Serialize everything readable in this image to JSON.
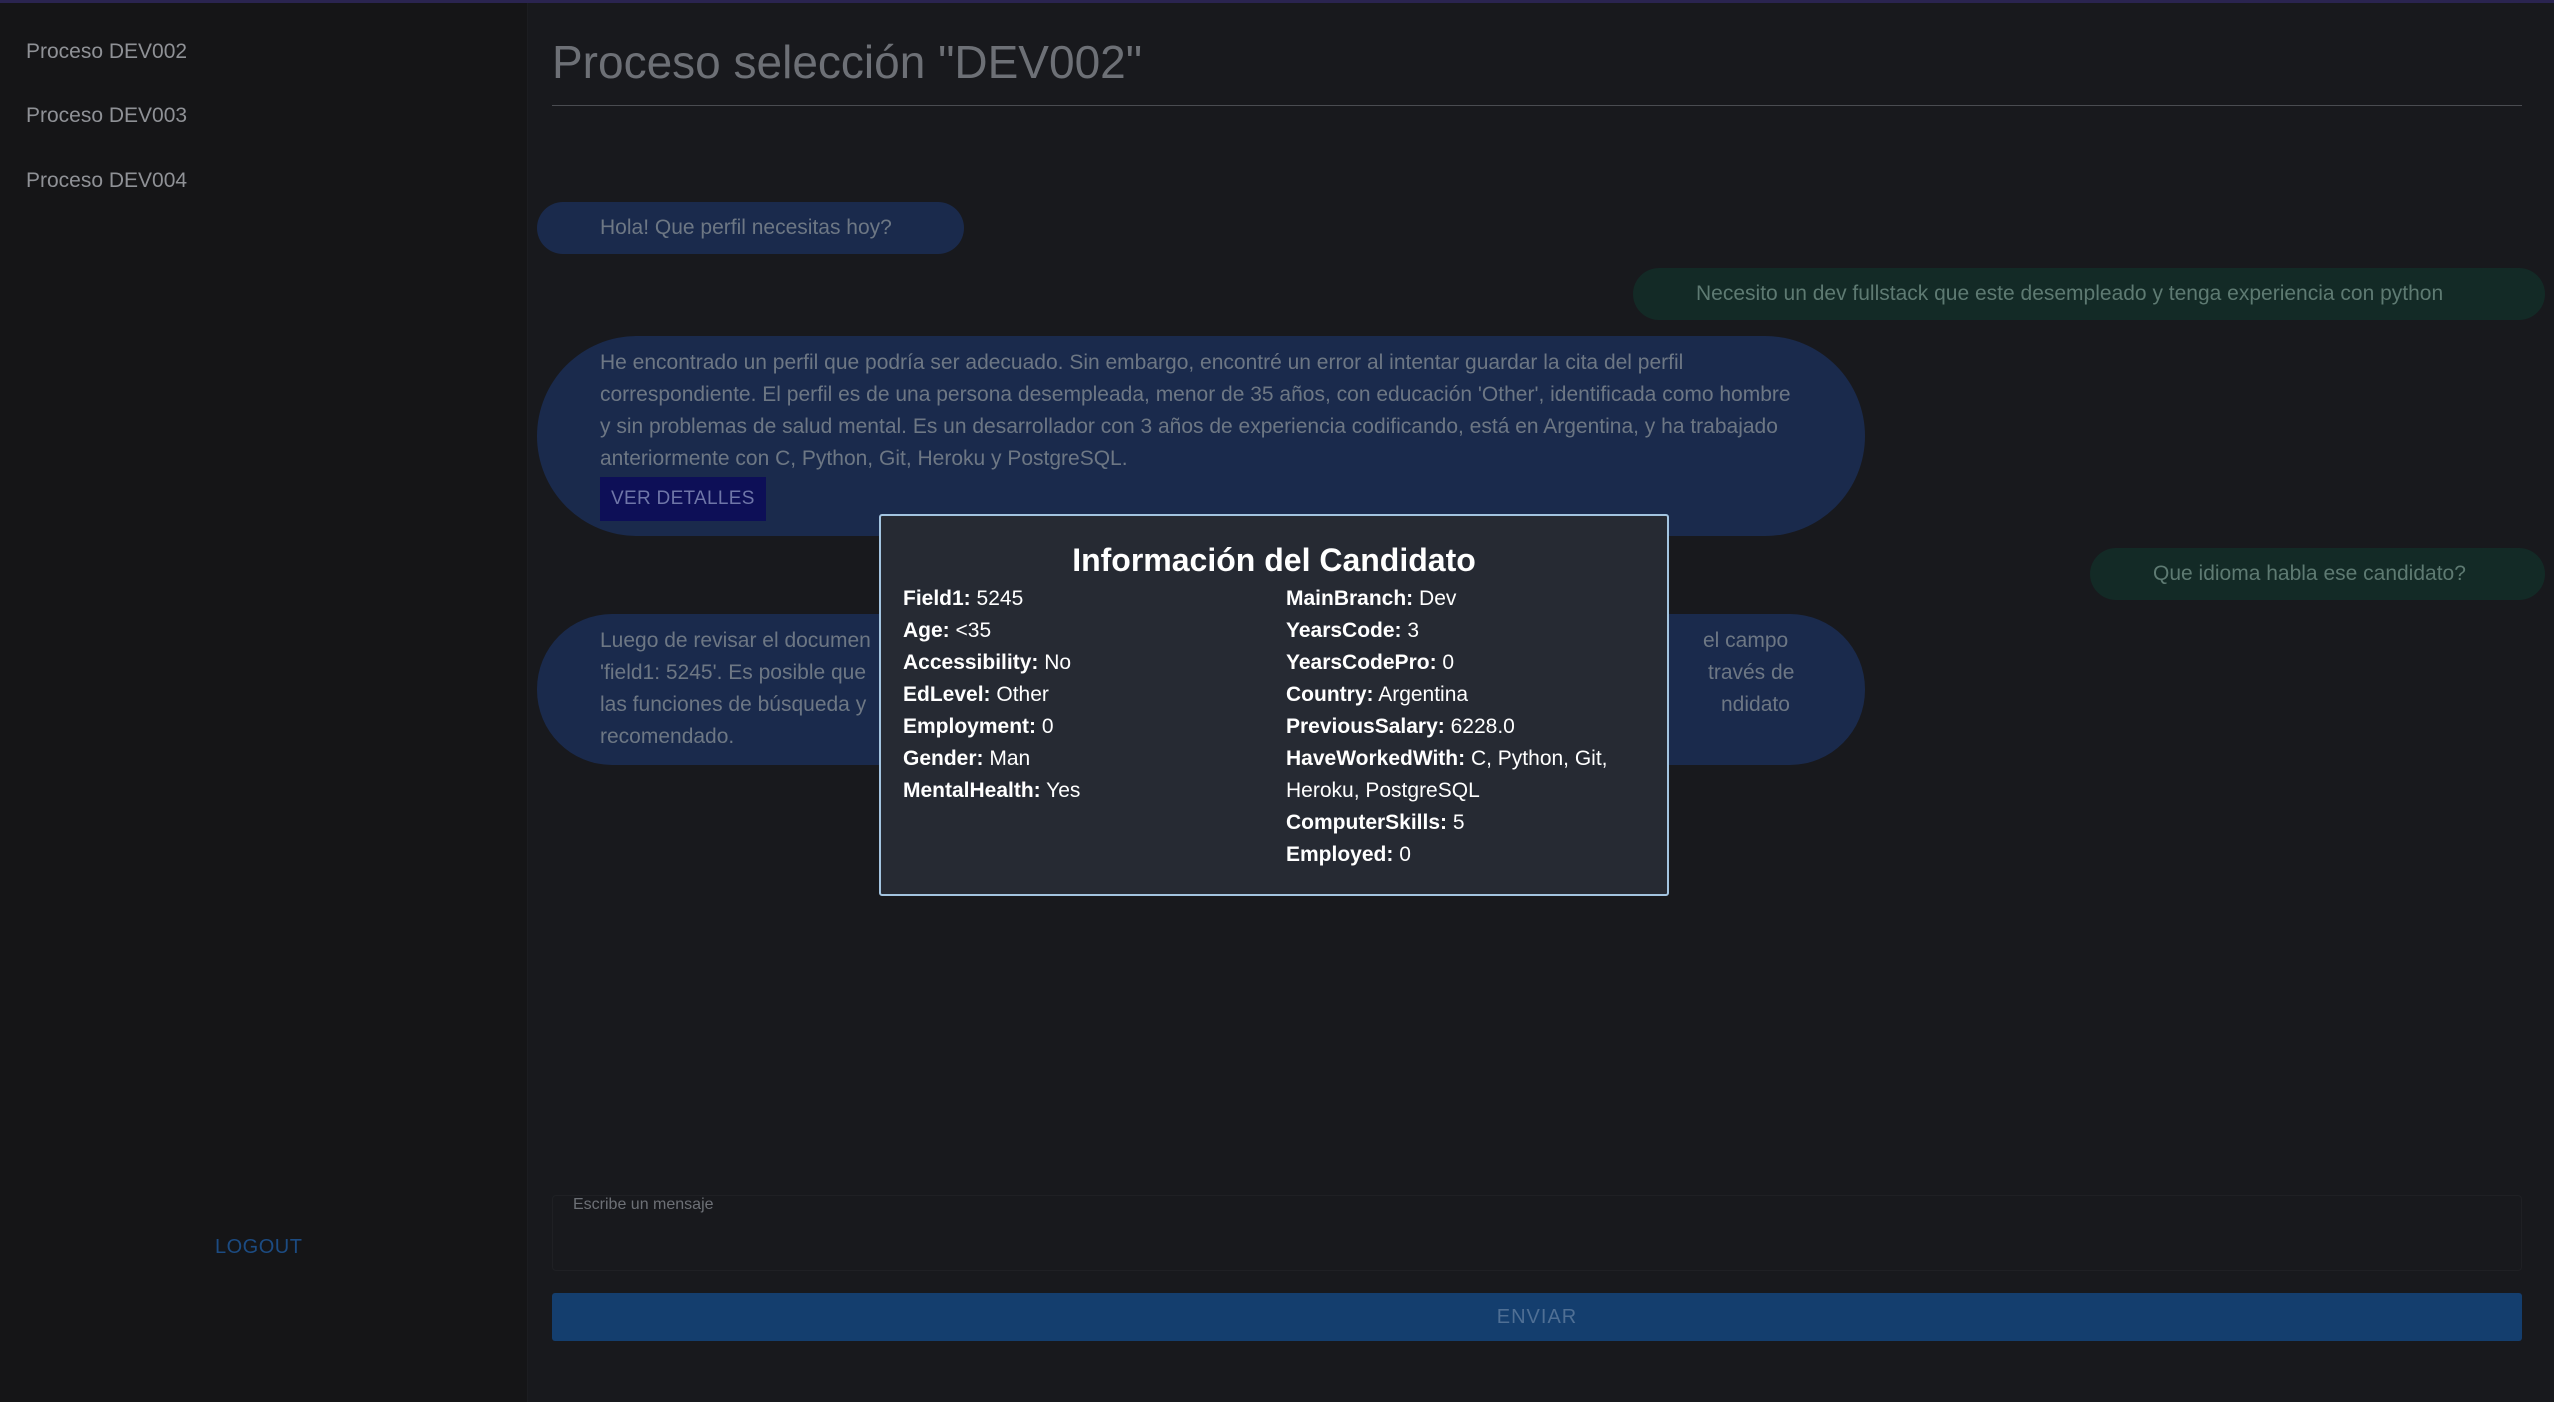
{
  "sidebar": {
    "items": [
      {
        "label": "Proceso DEV002"
      },
      {
        "label": "Proceso DEV003"
      },
      {
        "label": "Proceso DEV004"
      }
    ],
    "logout_label": "LOGOUT"
  },
  "main": {
    "title": "Proceso selección \"DEV002\"",
    "messages": [
      {
        "role": "bot",
        "text": "Hola! Que perfil necesitas hoy?"
      },
      {
        "role": "user",
        "text": "Necesito un dev fullstack que este desempleado y tenga experiencia con python"
      },
      {
        "role": "bot",
        "text": "He encontrado un perfil que podría ser adecuado. Sin embargo, encontré un error al intentar guardar la cita del perfil correspondiente. El perfil es de una persona desempleada, menor de 35 años, con educación 'Other', identificada como hombre y sin problemas de salud mental. Es un desarrollador con 3 años de experiencia codificando, está en Argentina, y ha trabajado anteriormente con C, Python, Git, Heroku y PostgreSQL.",
        "button": "VER DETALLES"
      },
      {
        "role": "user",
        "text": "Que idioma habla ese candidato?"
      },
      {
        "role": "bot",
        "text_visible_start": "Luego de revisar el documen",
        "text_line1_end": "el campo",
        "text_line2_start": "'field1: 5245'. Es posible que",
        "text_line2_end": "través de",
        "text_line3_start": "las funciones de búsqueda y",
        "text_line3_end": "ndidato",
        "text_line4": "recomendado."
      }
    ],
    "input": {
      "label": "Escribe un mensaje",
      "value": ""
    },
    "send_label": "ENVIAR"
  },
  "modal": {
    "title": "Información del Candidato",
    "left": [
      {
        "key": "Field1:",
        "value": "5245"
      },
      {
        "key": "Age:",
        "value": "<35"
      },
      {
        "key": "Accessibility:",
        "value": "No"
      },
      {
        "key": "EdLevel:",
        "value": "Other"
      },
      {
        "key": "Employment:",
        "value": "0"
      },
      {
        "key": "Gender:",
        "value": "Man"
      },
      {
        "key": "MentalHealth:",
        "value": "Yes"
      }
    ],
    "right": [
      {
        "key": "MainBranch:",
        "value": "Dev"
      },
      {
        "key": "YearsCode:",
        "value": "3"
      },
      {
        "key": "YearsCodePro:",
        "value": "0"
      },
      {
        "key": "Country:",
        "value": "Argentina"
      },
      {
        "key": "PreviousSalary:",
        "value": "6228.0"
      },
      {
        "key": "HaveWorkedWith:",
        "value": "C, Python, Git, Heroku, PostgreSQL"
      },
      {
        "key": "ComputerSkills:",
        "value": "5"
      },
      {
        "key": "Employed:",
        "value": "0"
      }
    ]
  },
  "colors": {
    "background": "#141518",
    "bot_bubble": "#1a2a4c",
    "user_bubble": "#132a26",
    "send_button": "#143e6e",
    "modal_border": "#a3c4e0",
    "details_button": "#0d0f57"
  }
}
